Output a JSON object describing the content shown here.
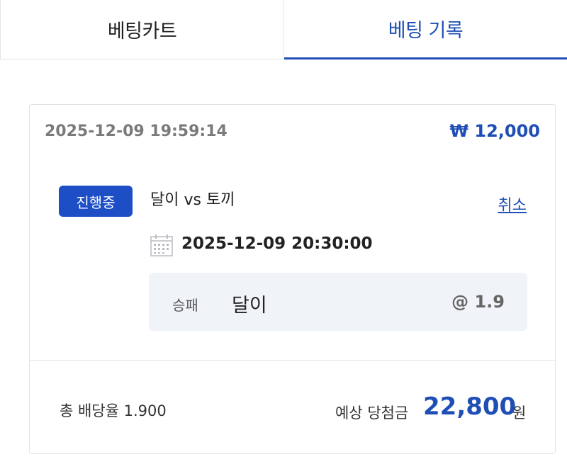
{
  "tabs": {
    "cart_label": "베팅카트",
    "history_label": "베팅 기록",
    "active": "history"
  },
  "bet": {
    "placed_at": "2025-12-09 19:59:14",
    "stake": "₩ 12,000",
    "status": "진행중",
    "match_title": "달이 vs 토끼",
    "cancel_label": "취소",
    "match_time": "2025-12-09 20:30:00",
    "selection": {
      "market": "승패",
      "pick": "달이",
      "odds": "@ 1.9"
    },
    "total_odds_label": "총 배당율 1.900",
    "expected_payout_label": "예상 당첨금",
    "expected_payout_value": "22,800",
    "currency_unit": "원"
  },
  "icons": {
    "calendar": "calendar-icon"
  },
  "colors": {
    "accent": "#1f4fb5",
    "badge": "#1d4ec6",
    "selection_bg": "#f0f4f8"
  }
}
